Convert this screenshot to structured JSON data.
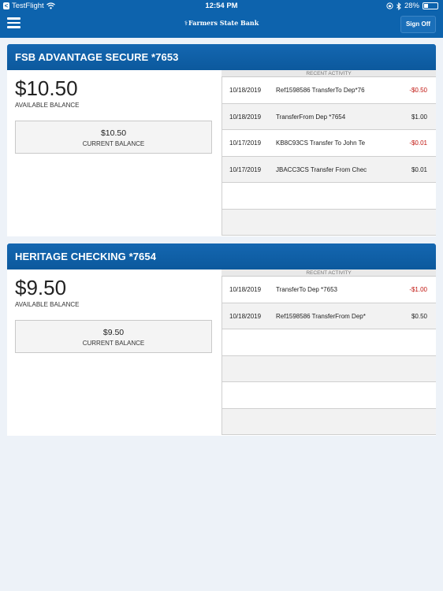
{
  "status_bar": {
    "back_badge": "<",
    "app": "TestFlight",
    "time": "12:54 PM",
    "battery": "28%",
    "battery_level": 0.28
  },
  "nav": {
    "menu_icon": "hamburger-icon",
    "brand_logo": "⚕",
    "brand": "Farmers State Bank",
    "sign_off_label": "Sign Off"
  },
  "accounts": [
    {
      "name": "FSB ADVANTAGE SECURE *7653",
      "available_balance": "$10.50",
      "available_label": "AVAILABLE BALANCE",
      "current_balance": "$10.50",
      "current_label": "CURRENT BALANCE",
      "activity_title": "RECENT ACTIVITY",
      "activity": [
        {
          "date": "10/18/2019",
          "desc": "Ref1598586 TransferTo Dep*76",
          "amount": "-$0.50",
          "negative": true
        },
        {
          "date": "10/18/2019",
          "desc": "TransferFrom Dep *7654",
          "amount": "$1.00",
          "negative": false
        },
        {
          "date": "10/17/2019",
          "desc": "KB8C93CS Transfer To John Te",
          "amount": "-$0.01",
          "negative": true
        },
        {
          "date": "10/17/2019",
          "desc": "JBACC3CS Transfer From Chec",
          "amount": "$0.01",
          "negative": false
        }
      ]
    },
    {
      "name": "HERITAGE CHECKING *7654",
      "available_balance": "$9.50",
      "available_label": "AVAILABLE BALANCE",
      "current_balance": "$9.50",
      "current_label": "CURRENT BALANCE",
      "activity_title": "RECENT ACTIVITY",
      "activity": [
        {
          "date": "10/18/2019",
          "desc": "TransferTo Dep *7653",
          "amount": "-$1.00",
          "negative": true
        },
        {
          "date": "10/18/2019",
          "desc": "Ref1598586 TransferFrom Dep*",
          "amount": "$0.50",
          "negative": false
        }
      ]
    }
  ],
  "colors": {
    "header_blue": "#0d63ad",
    "negative_red": "#c0150f",
    "background": "#edf2f8"
  }
}
